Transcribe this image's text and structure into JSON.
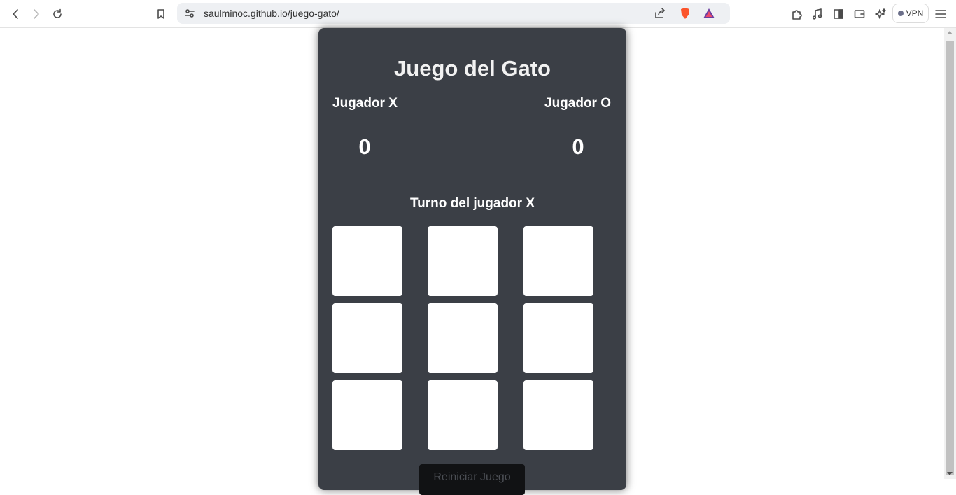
{
  "browser": {
    "url": "saulminoc.github.io/juego-gato/",
    "vpn_label": "VPN"
  },
  "game": {
    "title": "Juego del Gato",
    "player_x_label": "Jugador X",
    "player_o_label": "Jugador O",
    "score_x": "0",
    "score_o": "0",
    "turn_text": "Turno del jugador X",
    "reset_label": "Reiniciar Juego",
    "board": [
      "",
      "",
      "",
      "",
      "",
      "",
      "",
      "",
      ""
    ]
  }
}
